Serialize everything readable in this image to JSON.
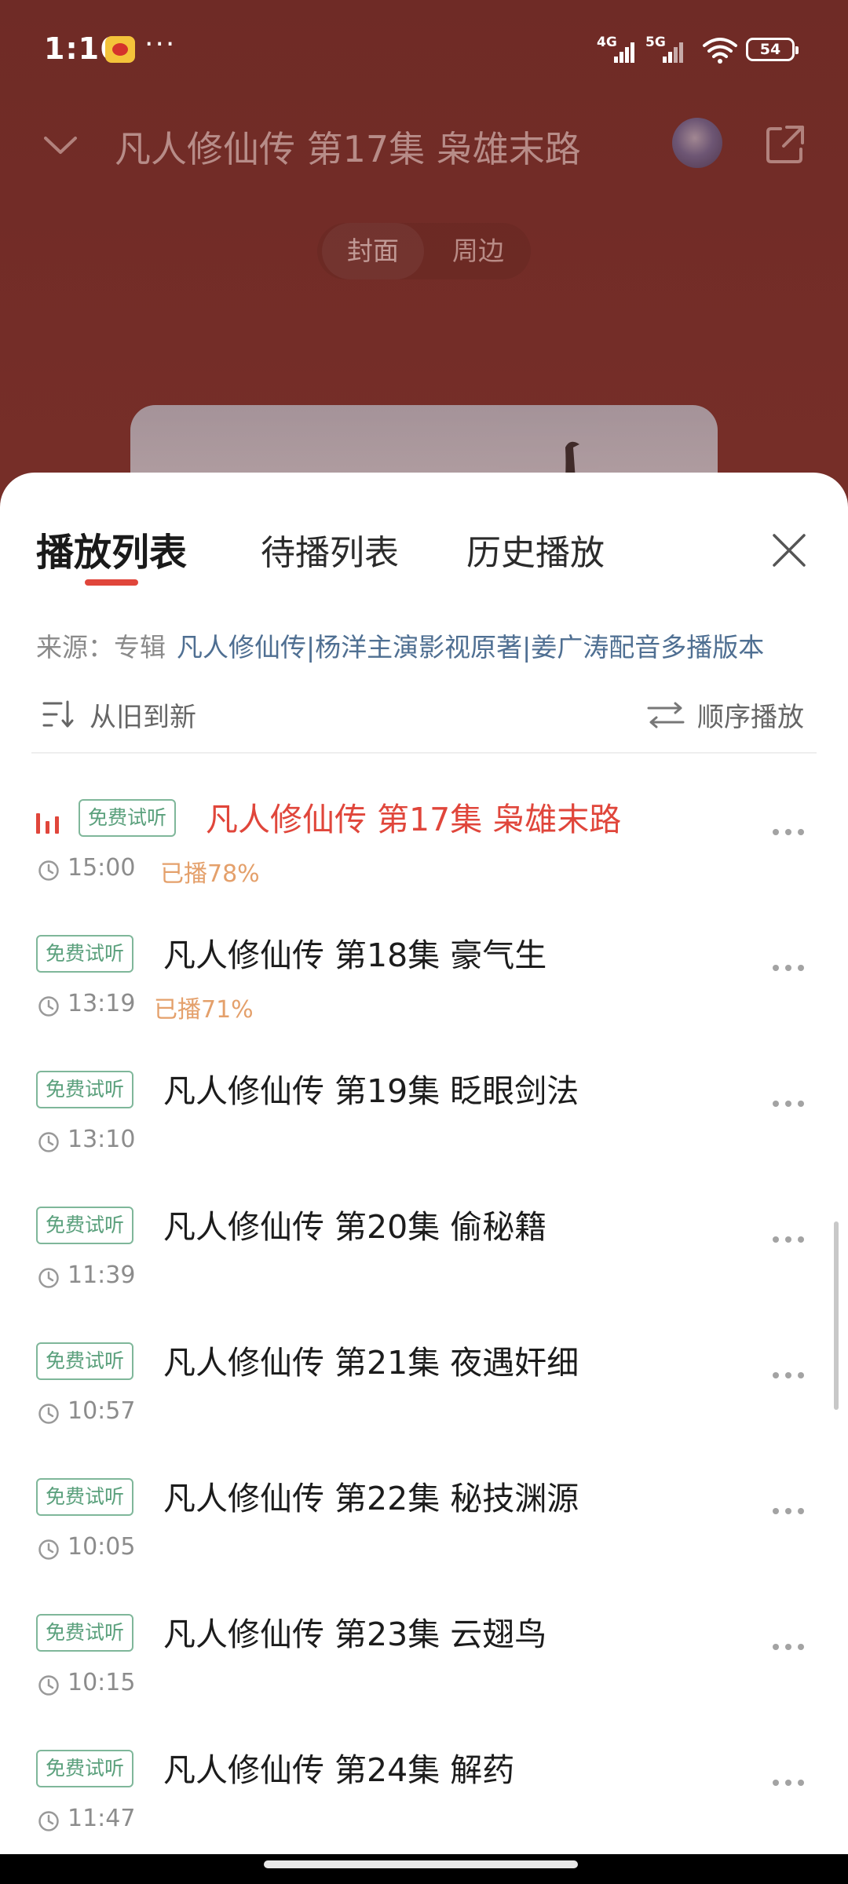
{
  "status_bar": {
    "time": "1:16",
    "dots": "···",
    "network_1": "4G",
    "network_2": "5G",
    "battery": "54"
  },
  "player": {
    "title": "凡人修仙传 第17集 枭雄末路",
    "segments": [
      "封面",
      "周边"
    ]
  },
  "sheet": {
    "tabs": [
      "播放列表",
      "待播列表",
      "历史播放"
    ],
    "source_label": "来源：专辑",
    "source_link": "凡人修仙传|杨洋主演影视原著|姜广涛配音多播版本",
    "sort_label": "从旧到新",
    "order_label": "顺序播放"
  },
  "episodes": [
    {
      "badge": "免费试听",
      "title": "凡人修仙传 第17集 枭雄末路",
      "duration": "15:00",
      "progress": "已播78%"
    },
    {
      "badge": "免费试听",
      "title": "凡人修仙传 第18集 豪气生",
      "duration": "13:19",
      "progress": "已播71%"
    },
    {
      "badge": "免费试听",
      "title": "凡人修仙传 第19集 眨眼剑法",
      "duration": "13:10",
      "progress": ""
    },
    {
      "badge": "免费试听",
      "title": "凡人修仙传 第20集 偷秘籍",
      "duration": "11:39",
      "progress": ""
    },
    {
      "badge": "免费试听",
      "title": "凡人修仙传 第21集 夜遇奸细",
      "duration": "10:57",
      "progress": ""
    },
    {
      "badge": "免费试听",
      "title": "凡人修仙传 第22集 秘技渊源",
      "duration": "10:05",
      "progress": ""
    },
    {
      "badge": "免费试听",
      "title": "凡人修仙传 第23集 云翅鸟",
      "duration": "10:15",
      "progress": ""
    },
    {
      "badge": "免费试听",
      "title": "凡人修仙传 第24集 解药",
      "duration": "11:47",
      "progress": ""
    }
  ],
  "colors": {
    "accent": "#e0463b",
    "free_badge": "#5aa07c",
    "progress": "#e4a06b",
    "link": "#4f6f92"
  }
}
